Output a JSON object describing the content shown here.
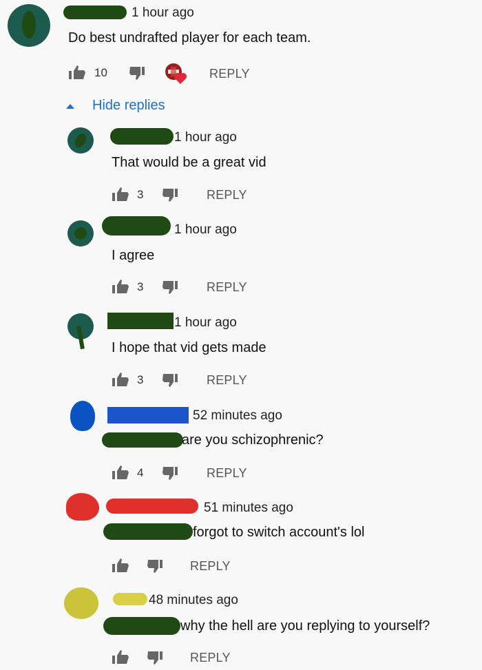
{
  "comments": [
    {
      "time": "1 hour ago",
      "text": "Do best undrafted player for each team.",
      "likes": "10",
      "reply_label": "REPLY",
      "avatar_color": "#1d5b4e",
      "scribble_color": "#1f4a14"
    }
  ],
  "hide_replies": {
    "label": "Hide replies",
    "color": "#1e6fcf"
  },
  "replies": [
    {
      "time": "1 hour ago",
      "text": "That would be a great vid",
      "likes": "3",
      "reply_label": "REPLY",
      "avatar_color": "#1d5b4e"
    },
    {
      "time": "1 hour ago",
      "text": "I agree",
      "likes": "3",
      "reply_label": "REPLY",
      "avatar_color": "#1d5b4e"
    },
    {
      "time": "1 hour ago",
      "text": "I hope that vid gets made",
      "likes": "3",
      "reply_label": "REPLY",
      "avatar_color": "#1d5b4e"
    },
    {
      "time": "52 minutes ago",
      "text": "are you schizophrenic?",
      "likes": "4",
      "reply_label": "REPLY",
      "avatar_color": "#0b52c2",
      "name_color": "#1b56c9"
    },
    {
      "time": "51 minutes ago",
      "text": "forgot to switch account's lol",
      "likes": "",
      "reply_label": "REPLY",
      "avatar_color": "#e0302c",
      "name_color": "#e0302c"
    },
    {
      "time": "48 minutes ago",
      "text": "why the hell are you replying to yourself?",
      "likes": "",
      "reply_label": "REPLY",
      "avatar_color": "#cbc43a",
      "name_color": "#d9cf47"
    }
  ],
  "icons": {
    "like": "thumbs-up-icon",
    "dislike": "thumbs-down-icon",
    "creator_heart": "creator-heart-icon",
    "collapse": "caret-up-icon"
  },
  "colors": {
    "redaction": "#1f4a14",
    "accent_blue": "#1e6fcf",
    "heart": "#e0273b"
  }
}
